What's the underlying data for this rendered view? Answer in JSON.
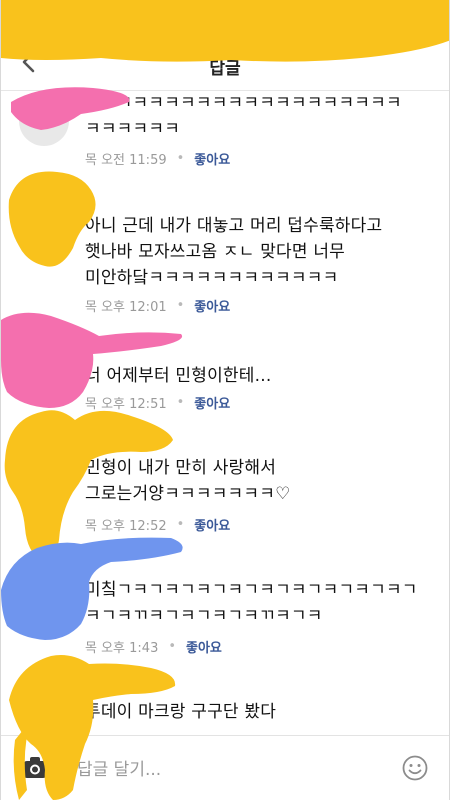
{
  "header": {
    "title": "답글",
    "back_icon": "chevron-left-icon"
  },
  "comments": [
    {
      "text": "ㅋㅋㅋㅋㅋㅋㅋㅋㅋㅋㅋㅋㅋㅋㅋㅋㅋㅋㅋㅋ\nㅋㅋㅋㅋㅋㅋ",
      "time": "목 오전 11:59",
      "like": "좋아요"
    },
    {
      "text": "아니 근데 내가 대놓고 머리 덥수룩하다고\n햇나바 모자쓰고옴 ㅈㄴ 맞다면 너무\n미안하닼ㅋㅋㅋㅋㅋㅋㅋㅋㅋㅋㅋㅋ",
      "time": "목 오후 12:01",
      "like": "좋아요"
    },
    {
      "text": "너 어제부터 민형이한테...",
      "time": "목 오후 12:51",
      "like": "좋아요"
    },
    {
      "text": "민형이 내가 만히 사랑해서\n그로는거양ㅋㅋㅋㅋㅋㅋㅋ♡",
      "time": "목 오후 12:52",
      "like": "좋아요"
    },
    {
      "text": "미칰ㄱㅋㄱㅋㄱㅋㄱㅋㄱㅋㄱㅋㄱㅋㄱㅋㄱㅋㄱ\nㅋㄱㅋㄲㅋㄱㅋㄱㅋㄱㅋㄲㅋㄱㅋ",
      "time": "목 오후 1:43",
      "like": "좋아요"
    },
    {
      "text": "투데이 마크랑 구구단 봤다",
      "time": "",
      "like": ""
    }
  ],
  "footer": {
    "placeholder": "답글 달기...",
    "camera_icon": "camera-icon",
    "emoji_icon": "smiley-icon"
  },
  "colors": {
    "scribble_yellow": "#F9C21C",
    "scribble_pink": "#F46FAE",
    "scribble_blue": "#6F95EE",
    "like_blue": "#3b5998"
  }
}
